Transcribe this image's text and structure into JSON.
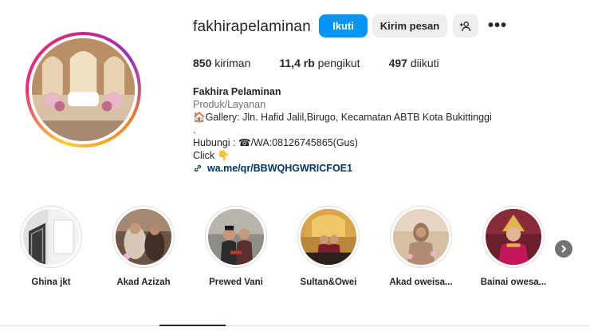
{
  "profile": {
    "username": "fakhirapelaminan",
    "follow_label": "Ikuti",
    "message_label": "Kirim pesan",
    "more_label": "•••"
  },
  "stats": {
    "posts_count": "850",
    "posts_label": "kiriman",
    "followers_count": "11,4 rb",
    "followers_label": "pengikut",
    "following_count": "497",
    "following_label": "diikuti"
  },
  "bio": {
    "name": "Fakhira Pelaminan",
    "category": "Produk/Layanan",
    "line1_icon": "🏠",
    "line1": "Gallery: Jln. Hafid Jalil,Birugo, Kecamatan ABTB Kota Bukittinggi",
    "line2": ".",
    "line3_prefix": "Hubungi : ",
    "line3_icon": "☎",
    "line3": "/WA:08126745865(Gus)",
    "line4": "Click",
    "line4_icon": "👇",
    "link": "wa.me/qr/BBWQHGWRICFOE1"
  },
  "highlights": [
    {
      "label": "Ghina jkt"
    },
    {
      "label": "Akad Azizah"
    },
    {
      "label": "Prewed Vani"
    },
    {
      "label": "Sultan&Owei"
    },
    {
      "label": "Akad oweisa..."
    },
    {
      "label": "Bainai owesa..."
    }
  ],
  "colors": {
    "accent": "#0095f6",
    "secondary_button": "#efefef",
    "link": "#00376b",
    "muted_text": "#737373"
  }
}
